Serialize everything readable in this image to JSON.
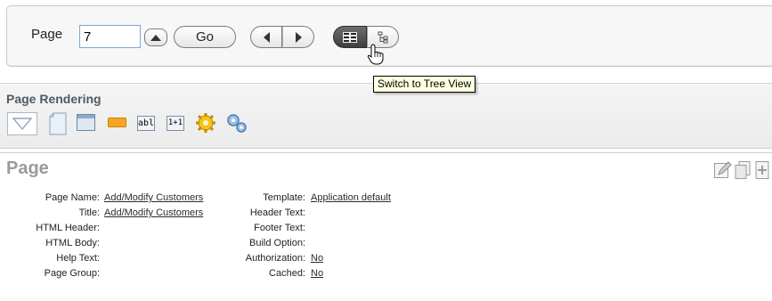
{
  "toolbar": {
    "page_label": "Page",
    "page_value": "7",
    "go_label": "Go"
  },
  "tooltip": "Switch to Tree View",
  "rendering": {
    "title": "Page Rendering",
    "icons": [
      "triangle-down-icon",
      "page-icon",
      "region-icon",
      "button-icon",
      "text-item-icon",
      "computation-icon",
      "gear-icon",
      "process-icon"
    ],
    "icon_text": {
      "text_item": "abl",
      "computation": "1+1"
    }
  },
  "page": {
    "title": "Page",
    "left": [
      {
        "label": "Page Name:",
        "value": "Add/Modify Customers"
      },
      {
        "label": "Title:",
        "value": "Add/Modify Customers"
      },
      {
        "label": "HTML Header:",
        "value": ""
      },
      {
        "label": "HTML Body:",
        "value": ""
      },
      {
        "label": "Help Text:",
        "value": ""
      },
      {
        "label": "Page Group:",
        "value": ""
      }
    ],
    "right": [
      {
        "label": "Template:",
        "value": "Application default"
      },
      {
        "label": "Header Text:",
        "value": ""
      },
      {
        "label": "Footer Text:",
        "value": ""
      },
      {
        "label": "Build Option:",
        "value": ""
      },
      {
        "label": "Authorization:",
        "value": "No"
      },
      {
        "label": "Cached:",
        "value": "No"
      }
    ]
  },
  "colors": {
    "toolbar_bg": "#f7f7f7",
    "rendering_title": "#505a66",
    "page_title": "#9a9a9a",
    "tooltip_bg": "#ffffe1",
    "input_border": "#7aa6d6"
  }
}
